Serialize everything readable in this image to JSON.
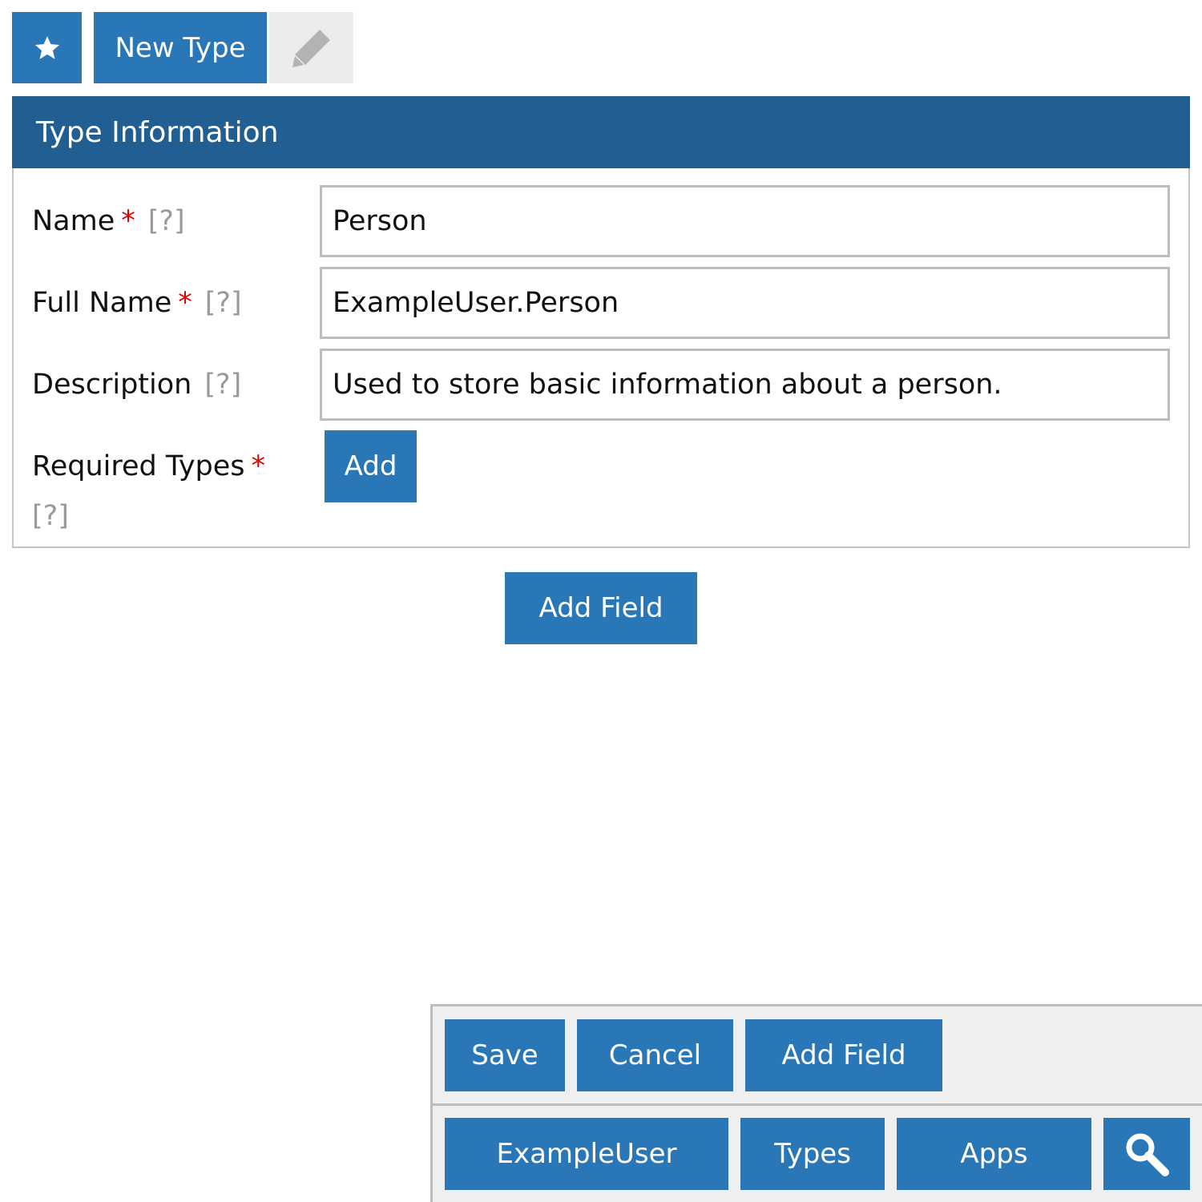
{
  "toolbar": {
    "star_icon": "star-icon",
    "title": "New Type",
    "edit_icon": "pencil-icon"
  },
  "panel": {
    "title": "Type Information",
    "help_text": "[?]",
    "fields": {
      "name": {
        "label": "Name",
        "value": "Person",
        "required": true
      },
      "full_name": {
        "label": "Full Name",
        "value": "ExampleUser.Person",
        "required": true
      },
      "description": {
        "label": "Description",
        "value": "Used to store basic information about a person.",
        "required": false
      },
      "required_types": {
        "label": "Required Types",
        "button": "Add",
        "required": true
      }
    },
    "required_marker": "*"
  },
  "main": {
    "add_field_label": "Add Field"
  },
  "bottom_bar": {
    "actions": {
      "save": "Save",
      "cancel": "Cancel",
      "add_field": "Add Field"
    },
    "nav": {
      "user": "ExampleUser",
      "types": "Types",
      "apps": "Apps",
      "search_icon": "search-icon"
    }
  },
  "colors": {
    "button_blue": "#2a77b8",
    "header_blue": "#215f93",
    "required_red": "#e00000"
  }
}
